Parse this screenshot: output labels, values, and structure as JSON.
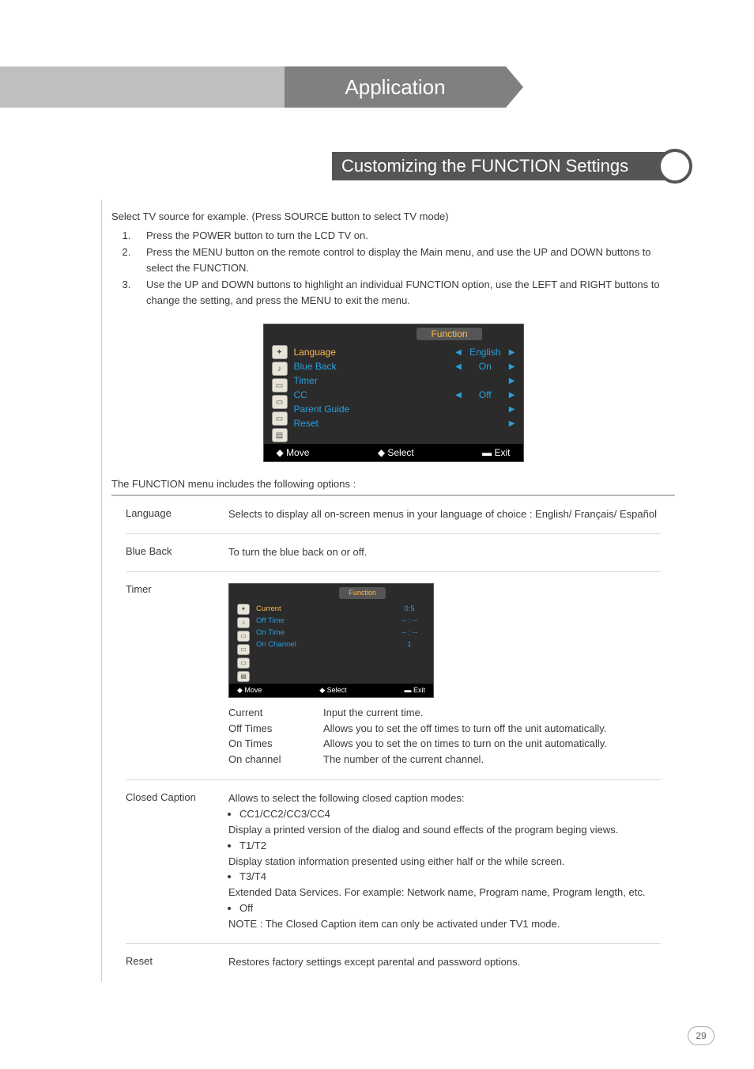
{
  "header": {
    "app_title": "Application",
    "section_title": "Customizing the FUNCTION Settings"
  },
  "intro": {
    "lead": "Select TV source for example. (Press SOURCE button to select TV mode)",
    "steps": [
      "Press the POWER button to turn the LCD TV on.",
      "Press the MENU button on the remote control to display the Main menu, and use the UP and DOWN buttons to select the FUNCTION.",
      "Use the UP and DOWN buttons to highlight an individual FUNCTION option, use the LEFT and RIGHT buttons to change the setting, and press the MENU to exit the menu."
    ]
  },
  "osd_main": {
    "title": "Function",
    "rows": [
      {
        "label": "Language",
        "value": "English",
        "lr": true,
        "sel": true
      },
      {
        "label": "Blue Back",
        "value": "On",
        "lr": true
      },
      {
        "label": "Timer",
        "value": "",
        "lr": false
      },
      {
        "label": "CC",
        "value": "Off",
        "lr": true
      },
      {
        "label": "Parent Guide",
        "value": "",
        "lr": false
      },
      {
        "label": "Reset",
        "value": "",
        "lr": false
      }
    ],
    "foot_move": "Move",
    "foot_select": "Select",
    "foot_exit": "Exit"
  },
  "options_lead": "The FUNCTION menu includes the following options :",
  "options": {
    "language_label": "Language",
    "language_desc": "Selects to display all on-screen menus in your language of choice : English/ Français/ Español",
    "blueback_label": "Blue Back",
    "blueback_desc": "To turn the blue back on or off.",
    "timer_label": "Timer",
    "timer_osd": {
      "title": "Function",
      "rows": [
        {
          "label": "Current",
          "value": "0:5",
          "sel": true
        },
        {
          "label": "Off Time",
          "value": "-- : --"
        },
        {
          "label": "On Time",
          "value": "-- : --"
        },
        {
          "label": "On Channel",
          "value": "1"
        }
      ],
      "foot_move": "Move",
      "foot_select": "Select",
      "foot_exit": "Exit"
    },
    "timer_defs": [
      {
        "k": "Current",
        "v": "Input the current time."
      },
      {
        "k": "Off Times",
        "v": "Allows you to set the off times to turn off the unit automatically."
      },
      {
        "k": "On Times",
        "v": "Allows you to set the on times to turn on the unit automatically."
      },
      {
        "k": "On channel",
        "v": "The number of the current channel."
      }
    ],
    "cc_label": "Closed Caption",
    "cc_lead": "Allows to select the following closed caption modes:",
    "cc_b1": "CC1/CC2/CC3/CC4",
    "cc_t1": "Display a printed version of the dialog and sound effects of the program beging views.",
    "cc_b2": "T1/T2",
    "cc_t2": "Display station information presented using either half or the while screen.",
    "cc_b3": "T3/T4",
    "cc_t3": "Extended Data Services. For example: Network name, Program name, Program length, etc.",
    "cc_b4": "Off",
    "cc_note": "NOTE : The Closed Caption item can only be activated under TV1 mode.",
    "reset_label": "Reset",
    "reset_desc": "Restores factory settings except parental and password options."
  },
  "page_number": "29"
}
